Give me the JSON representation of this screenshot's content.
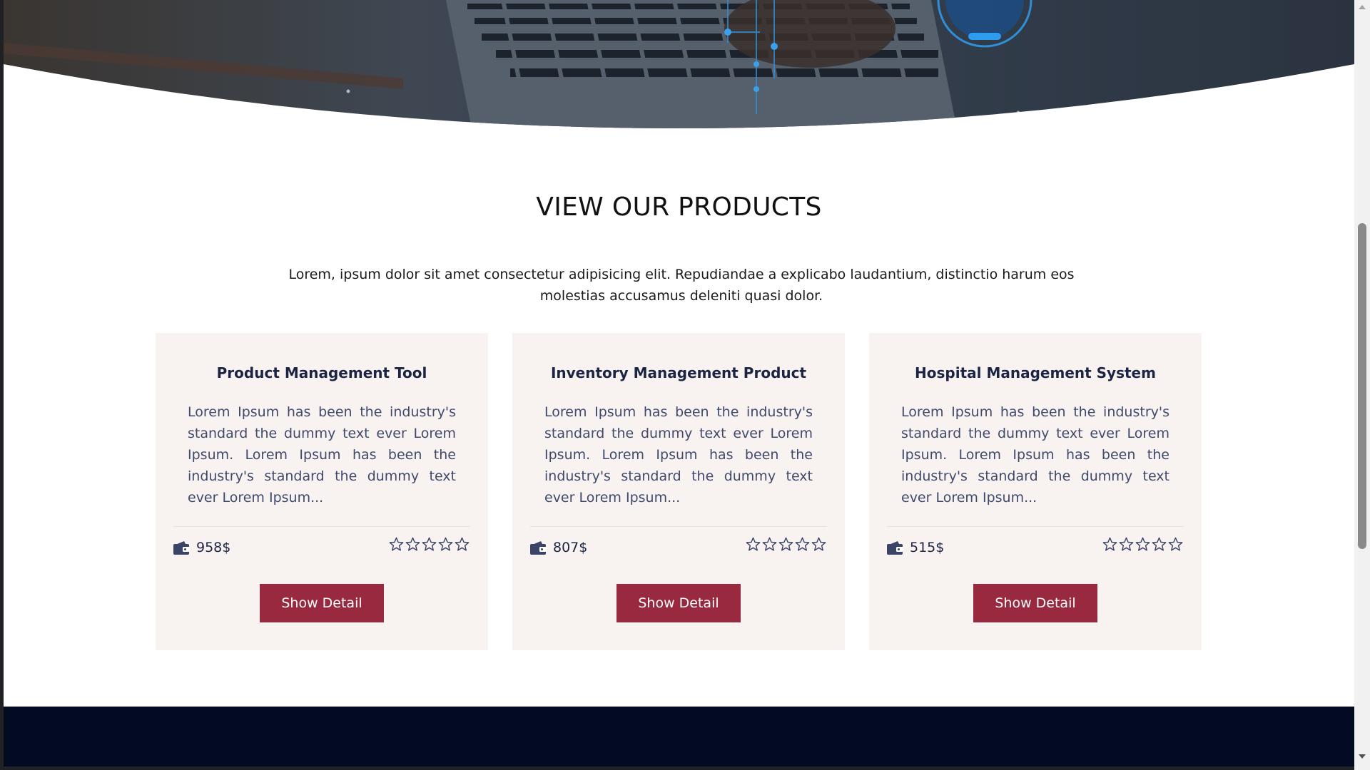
{
  "section": {
    "title": "VIEW OUR PRODUCTS",
    "description": "Lorem, ipsum dolor sit amet consectetur adipisicing elit. Repudiandae a explicabo laudantium, distinctio harum eos molestias accusamus deleniti quasi dolor."
  },
  "products": [
    {
      "title": "Product Management Tool",
      "text": "Lorem Ipsum has been the industry's standard the dummy text ever Lorem Ipsum. Lorem Ipsum has been the industry's standard the dummy text ever Lorem Ipsum...",
      "price": "958$",
      "rating": 0,
      "rating_max": 5,
      "button_label": "Show Detail"
    },
    {
      "title": "Inventory Management Product",
      "text": "Lorem Ipsum has been the industry's standard the dummy text ever Lorem Ipsum. Lorem Ipsum has been the industry's standard the dummy text ever Lorem Ipsum...",
      "price": "807$",
      "rating": 0,
      "rating_max": 5,
      "button_label": "Show Detail"
    },
    {
      "title": "Hospital Management System",
      "text": "Lorem Ipsum has been the industry's standard the dummy text ever Lorem Ipsum. Lorem Ipsum has been the industry's standard the dummy text ever Lorem Ipsum...",
      "price": "515$",
      "rating": 0,
      "rating_max": 5,
      "button_label": "Show Detail"
    }
  ],
  "icons": {
    "price": "wallet-icon",
    "rating": "star-outline-icon"
  },
  "colors": {
    "accent": "#98293f",
    "card_background": "#f8f2f1",
    "title_text": "#1c2444",
    "body_text": "#3f4a6b",
    "footer": "#020b22"
  }
}
